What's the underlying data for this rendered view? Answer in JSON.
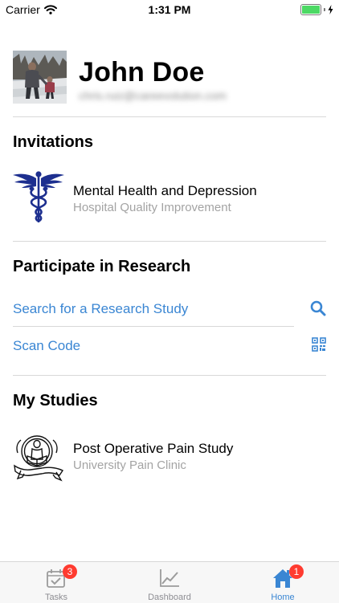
{
  "status_bar": {
    "carrier": "Carrier",
    "time": "1:31 PM"
  },
  "profile": {
    "name": "John Doe",
    "email": "chris.ruiz@careevolution.com"
  },
  "invitations": {
    "title": "Invitations",
    "items": [
      {
        "title": "Mental Health and Depression",
        "subtitle": "Hospital Quality Improvement",
        "icon": "caduceus-icon"
      }
    ]
  },
  "research": {
    "title": "Participate in Research",
    "search_label": "Search for a Research Study",
    "scan_label": "Scan Code"
  },
  "my_studies": {
    "title": "My Studies",
    "items": [
      {
        "title": "Post Operative Pain Study",
        "subtitle": "University Pain Clinic",
        "icon": "reader-emblem-icon"
      }
    ]
  },
  "tab_bar": {
    "tabs": [
      {
        "label": "Tasks",
        "badge": "3"
      },
      {
        "label": "Dashboard",
        "badge": ""
      },
      {
        "label": "Home",
        "badge": "1"
      }
    ]
  },
  "colors": {
    "accent": "#3a86d3",
    "badge": "#ff3b30",
    "subtitle": "#a3a3a3"
  }
}
